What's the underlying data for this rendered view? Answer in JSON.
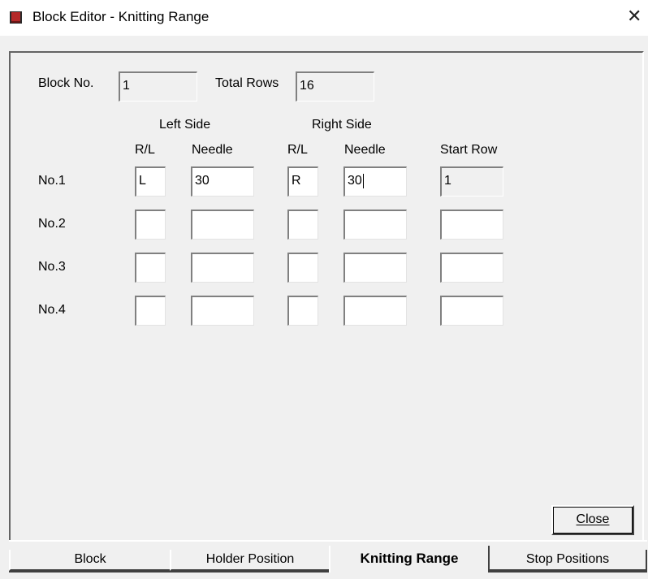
{
  "window": {
    "title": "Block Editor - Knitting Range",
    "close_glyph": "✕"
  },
  "header": {
    "block_no_label": "Block No.",
    "block_no_value": "1",
    "total_rows_label": "Total Rows",
    "total_rows_value": "16"
  },
  "groups": {
    "left_side": "Left Side",
    "right_side": "Right Side"
  },
  "columns": {
    "left_rl": "R/L",
    "left_needle": "Needle",
    "right_rl": "R/L",
    "right_needle": "Needle",
    "start_row": "Start Row"
  },
  "rows": [
    {
      "label": "No.1",
      "left_rl": "L",
      "left_needle": "30",
      "right_rl": "R",
      "right_needle": "30",
      "start_row": "1"
    },
    {
      "label": "No.2",
      "left_rl": "",
      "left_needle": "",
      "right_rl": "",
      "right_needle": "",
      "start_row": ""
    },
    {
      "label": "No.3",
      "left_rl": "",
      "left_needle": "",
      "right_rl": "",
      "right_needle": "",
      "start_row": ""
    },
    {
      "label": "No.4",
      "left_rl": "",
      "left_needle": "",
      "right_rl": "",
      "right_needle": "",
      "start_row": ""
    }
  ],
  "buttons": {
    "close_label": "Close"
  },
  "tabs": [
    {
      "label": "Block",
      "active": false
    },
    {
      "label": "Holder Position",
      "active": false
    },
    {
      "label": "Knitting Range",
      "active": true
    },
    {
      "label": "Stop Positions",
      "active": false
    }
  ],
  "colors": {
    "dialog_bg": "#f0f0f0",
    "field_bg": "#ffffff",
    "app_icon": "#b52a2a"
  }
}
